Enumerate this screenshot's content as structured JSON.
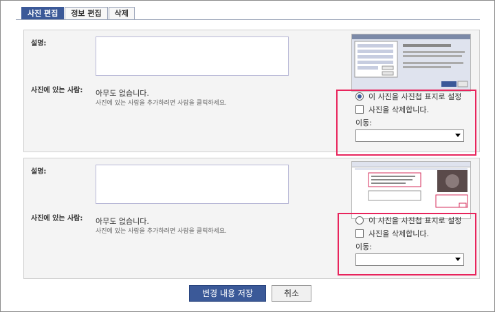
{
  "tabs": [
    {
      "label": "사진 편집",
      "active": true
    },
    {
      "label": "정보 편집",
      "active": false
    },
    {
      "label": "삭제",
      "active": false
    }
  ],
  "photos": [
    {
      "caption_label": "설명:",
      "caption_value": "",
      "people_label": "사진에 있는 사람:",
      "people_none": "아무도 없습니다.",
      "people_hint": "사진에 있는 사람을 추가하려면 사람을 클릭하세요.",
      "cover_option": "이 사진을 사진첩 표지로 설정",
      "cover_selected": true,
      "delete_option": "사진을 삭제합니다.",
      "move_label": "이동:",
      "move_value": ""
    },
    {
      "caption_label": "설명:",
      "caption_value": "",
      "people_label": "사진에 있는 사람:",
      "people_none": "아무도 없습니다.",
      "people_hint": "사진에 있는 사람을 추가하려면 사람을 클릭하세요.",
      "cover_option": "이 사진을 사진첩 표지로 설정",
      "cover_selected": false,
      "delete_option": "사진을 삭제합니다.",
      "move_label": "이동:",
      "move_value": ""
    }
  ],
  "buttons": {
    "save": "변경 내용 저장",
    "cancel": "취소"
  },
  "colors": {
    "accent": "#3b5998",
    "highlight": "#e8245c"
  }
}
